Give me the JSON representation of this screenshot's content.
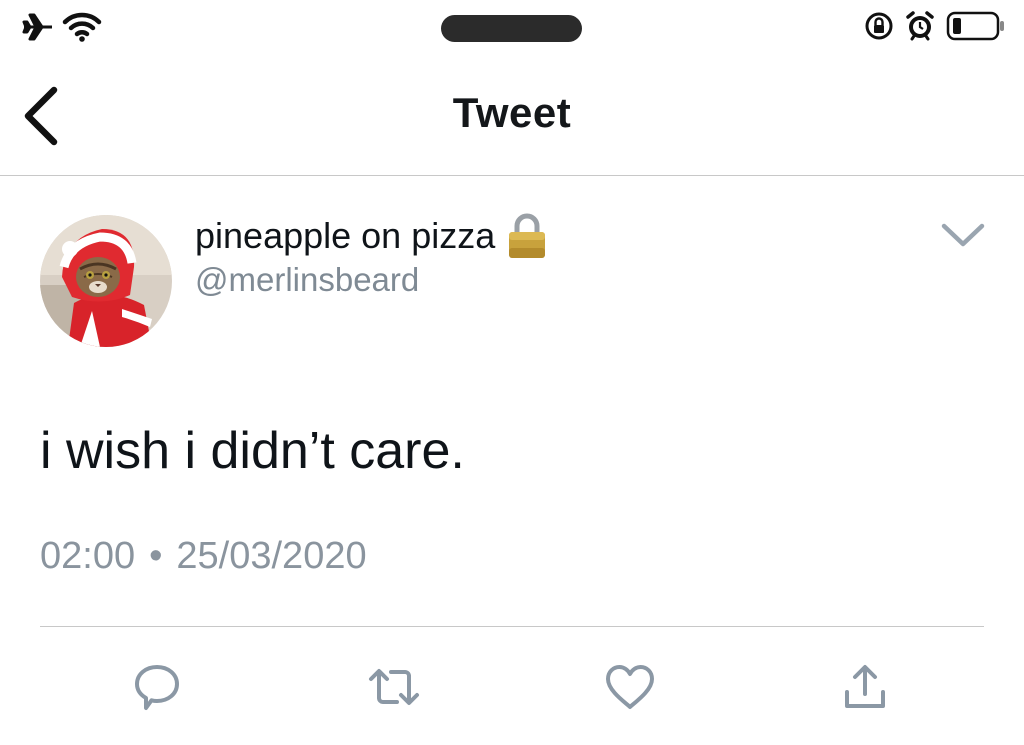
{
  "status_bar": {
    "left_icons": [
      "airplane-icon",
      "wifi-icon"
    ],
    "right_icons": [
      "orientation-lock-icon",
      "alarm-icon",
      "battery-icon"
    ]
  },
  "nav": {
    "back_icon": "chevron-left-icon",
    "title": "Tweet"
  },
  "tweet": {
    "display_name": "pineapple on pizza",
    "protected_icon": "lock-icon",
    "handle": "@merlinsbeard",
    "menu_icon": "chevron-down-icon",
    "text": "i wish i didn’t care.",
    "time": "02:00",
    "separator": "•",
    "date": "25/03/2020"
  },
  "actions": [
    {
      "name": "reply",
      "icon": "reply-icon"
    },
    {
      "name": "retweet",
      "icon": "retweet-icon"
    },
    {
      "name": "like",
      "icon": "heart-icon"
    },
    {
      "name": "share",
      "icon": "share-icon"
    }
  ],
  "colors": {
    "text_primary": "#0f1419",
    "text_secondary": "#7f8a94",
    "icon_grey": "#8b98a5",
    "divider": "#c8c8c8",
    "lock_gold": "#c8a23c"
  }
}
